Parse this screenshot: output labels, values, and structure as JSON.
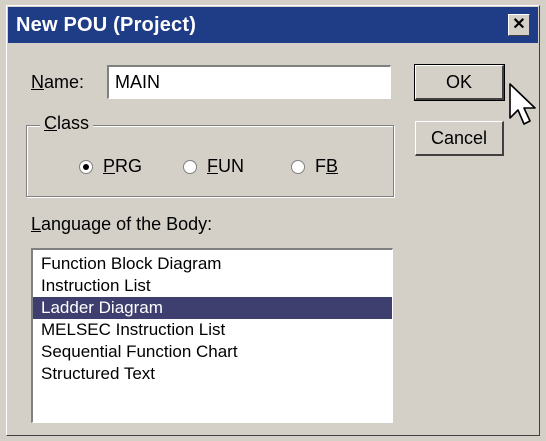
{
  "window": {
    "title": "New POU (Project)",
    "close_glyph": "✕"
  },
  "name_field": {
    "label_accel": "N",
    "label_rest": "ame:",
    "value": "MAIN"
  },
  "class_group": {
    "legend_accel": "C",
    "legend_rest": "lass",
    "options": [
      {
        "accel": "P",
        "rest": "RG",
        "checked": true
      },
      {
        "accel": "F",
        "rest": "UN",
        "checked": false
      },
      {
        "pre": "F",
        "accel": "B",
        "checked": false
      }
    ]
  },
  "language": {
    "label_accel": "L",
    "label_rest": "anguage of the Body:",
    "items": [
      "Function Block Diagram",
      "Instruction List",
      "Ladder Diagram",
      "MELSEC Instruction List",
      "Sequential Function Chart",
      "Structured Text"
    ],
    "selected_index": 2
  },
  "buttons": {
    "ok": "OK",
    "cancel": "Cancel"
  },
  "colors": {
    "titlebar": "#1f3c87",
    "selection": "#3e3f6e",
    "face": "#d4d0c8"
  },
  "icons": {
    "cursor": "arrow-cursor-icon"
  }
}
